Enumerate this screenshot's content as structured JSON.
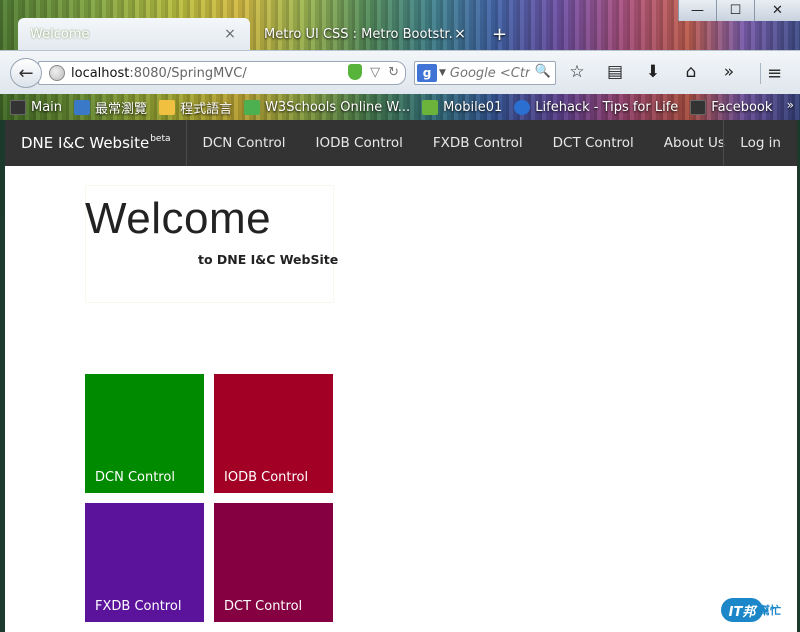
{
  "browser": {
    "tabs": [
      {
        "title": "Welcome",
        "close": "×",
        "active": true
      },
      {
        "title": "Metro UI CSS : Metro Bootstr...",
        "close": "×",
        "active": false
      }
    ],
    "new_tab": "+",
    "window_controls": {
      "minimize": "—",
      "maximize": "☐",
      "close": "✕"
    },
    "url": {
      "host": "localhost",
      "path": ":8080/SpringMVC/"
    },
    "search": {
      "engine_glyph": "g",
      "placeholder": "Google <Ctr..."
    },
    "bookmarks": [
      {
        "label": "Main",
        "icon": "page-icon",
        "color": "#333333"
      },
      {
        "label": "最常瀏覽",
        "icon": "magnifier-icon",
        "color": "#3a78c8"
      },
      {
        "label": "程式語言",
        "icon": "folder-icon",
        "color": "#f0c040"
      },
      {
        "label": "W3Schools Online W...",
        "icon": "w3-icon",
        "color": "#4caf50"
      },
      {
        "label": "Mobile01",
        "icon": "mobile01-icon",
        "color": "#6bb33a"
      },
      {
        "label": "Lifehack - Tips for Life",
        "icon": "lifehack-icon",
        "color": "#2b6fd1"
      },
      {
        "label": "Facebook",
        "icon": "page-icon",
        "color": "#333333"
      }
    ],
    "bookmarks_overflow": "»"
  },
  "site": {
    "brand": "DNE I&C Website",
    "brand_sup": "beta",
    "nav": [
      "DCN Control",
      "IODB Control",
      "FXDB Control",
      "DCT Control",
      "About Us"
    ],
    "login": "Log in",
    "welcome_title": "Welcome",
    "welcome_sub": "to DNE I&C WebSite",
    "tiles": [
      {
        "label": "DCN Control",
        "color": "#008a00"
      },
      {
        "label": "IODB Control",
        "color": "#a20025"
      },
      {
        "label": "FXDB Control",
        "color": "#5b139c"
      },
      {
        "label": "DCT Control",
        "color": "#850041"
      }
    ]
  },
  "watermark": {
    "badge": "IT邦",
    "text": "幫忙"
  }
}
